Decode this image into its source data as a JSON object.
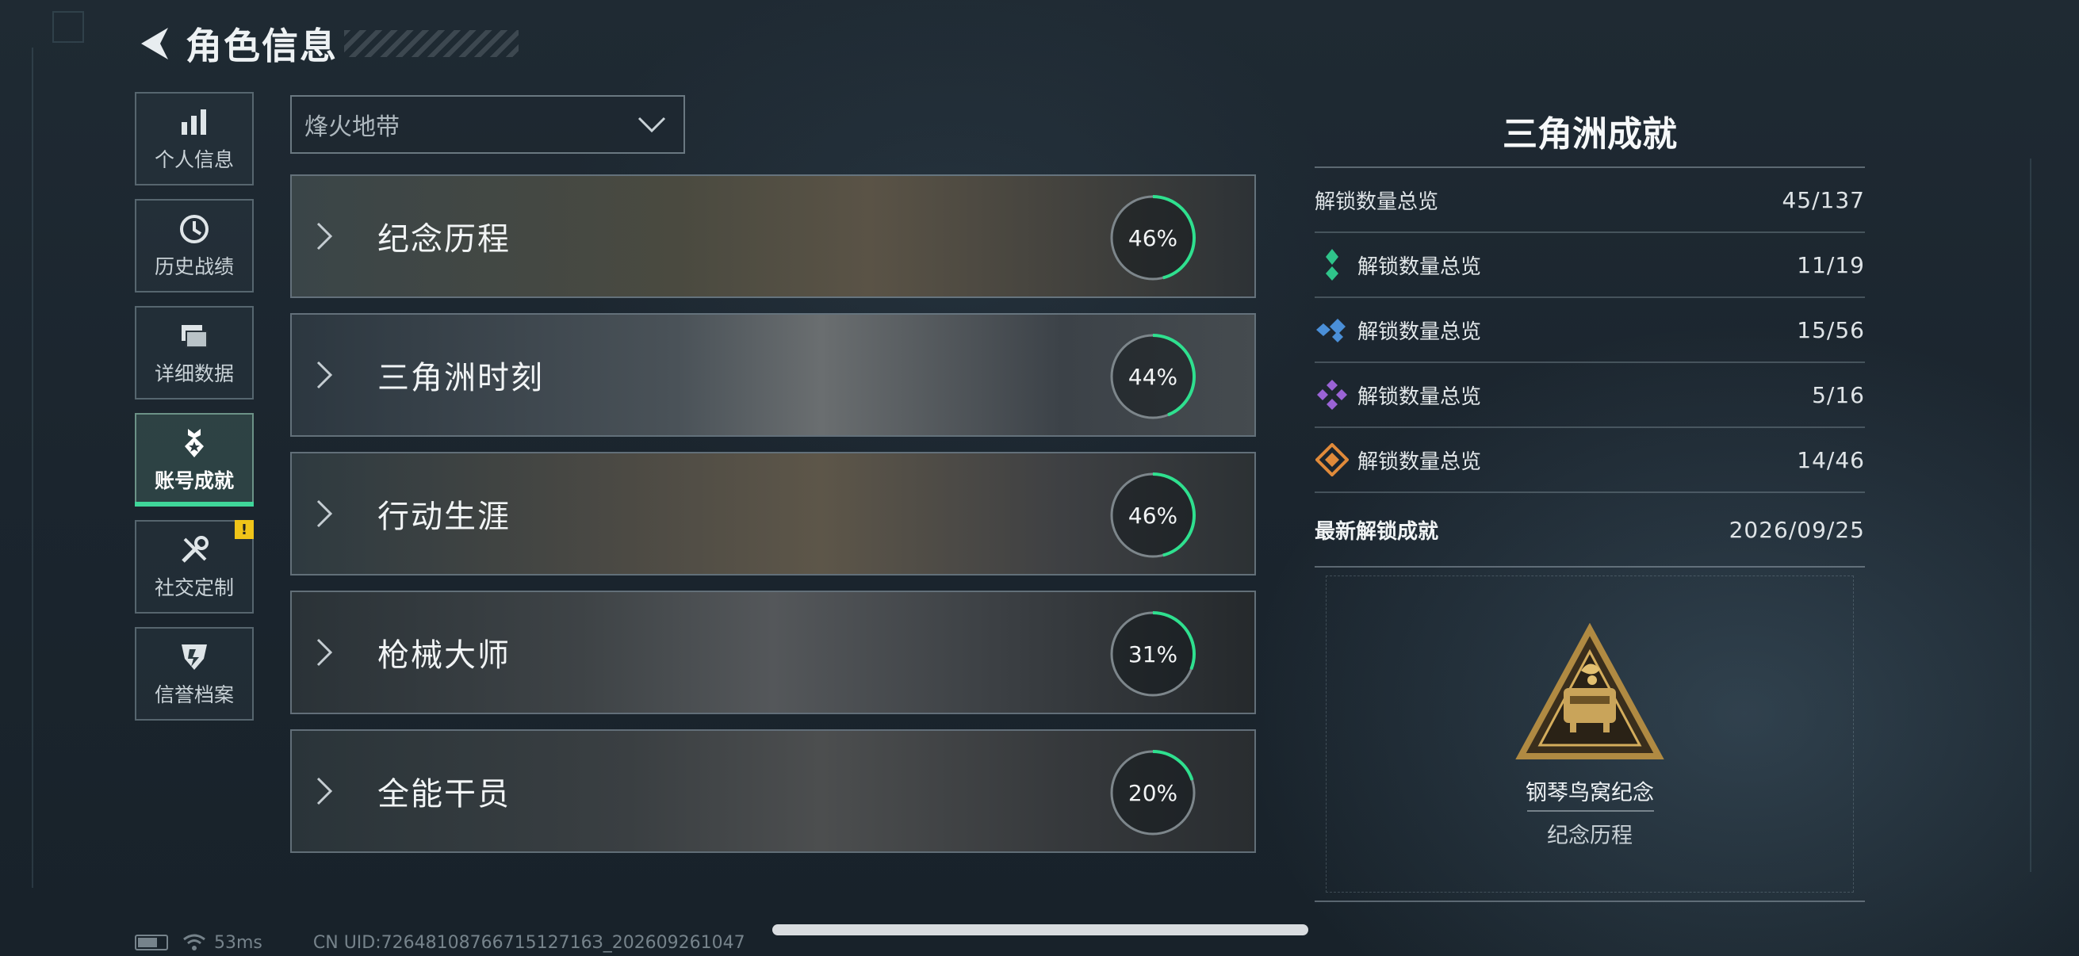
{
  "header": {
    "title": "角色信息"
  },
  "sidebar": {
    "items": [
      {
        "label": "个人信息",
        "icon": "bar-chart-icon"
      },
      {
        "label": "历史战绩",
        "icon": "history-clock-icon"
      },
      {
        "label": "详细数据",
        "icon": "folder-stack-icon"
      },
      {
        "label": "账号成就",
        "icon": "medal-icon",
        "active": true
      },
      {
        "label": "社交定制",
        "icon": "tools-icon",
        "badge": "!"
      },
      {
        "label": "信誉档案",
        "icon": "shield-icon"
      }
    ]
  },
  "filter": {
    "selected": "烽火地带"
  },
  "categories": [
    {
      "name": "纪念历程",
      "percent": "46%",
      "progress": 0.46
    },
    {
      "name": "三角洲时刻",
      "percent": "44%",
      "progress": 0.44
    },
    {
      "name": "行动生涯",
      "percent": "46%",
      "progress": 0.46
    },
    {
      "name": "枪械大师",
      "percent": "31%",
      "progress": 0.31
    },
    {
      "name": "全能干员",
      "percent": "20%",
      "progress": 0.2
    }
  ],
  "panel": {
    "title": "三角洲成就",
    "total": {
      "label": "解锁数量总览",
      "value": "45/137"
    },
    "tiers": [
      {
        "label": "解锁数量总览",
        "value": "11/19",
        "color": "#2fc48a",
        "icon": "green-tier-icon"
      },
      {
        "label": "解锁数量总览",
        "value": "15/56",
        "color": "#4a8fd8",
        "icon": "blue-tier-icon"
      },
      {
        "label": "解锁数量总览",
        "value": "5/16",
        "color": "#9a63d6",
        "icon": "purple-tier-icon"
      },
      {
        "label": "解锁数量总览",
        "value": "14/46",
        "color": "#e08a3a",
        "icon": "orange-tier-icon"
      }
    ],
    "latest": {
      "label": "最新解锁成就",
      "date": "2026/09/25"
    },
    "achievement": {
      "name": "钢琴鸟窝纪念",
      "category": "纪念历程"
    }
  },
  "footer": {
    "ping": "53ms",
    "uid": "CN UID:7264810876671512716З_202609261047"
  }
}
